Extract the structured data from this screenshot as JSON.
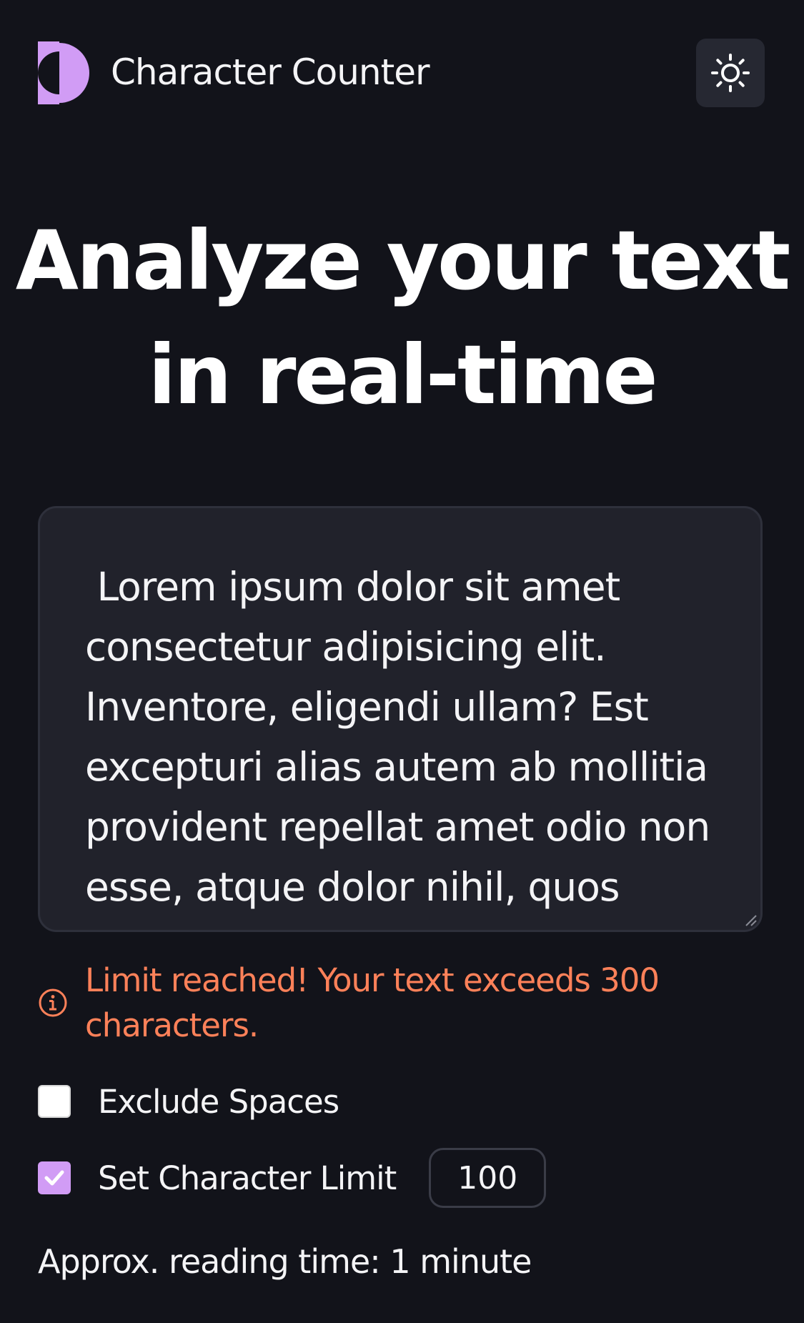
{
  "header": {
    "title": "Character Counter",
    "logo_icon": "half-moon-logo",
    "theme_toggle_icon": "sun-icon"
  },
  "hero": {
    "line1": "Analyze your text",
    "line2": "in real-time"
  },
  "textarea": {
    "value": " Lorem ipsum dolor sit amet consectetur adipisicing elit. Inventore, eligendi ullam? Est excepturi alias autem ab mollitia provident repellat amet odio non esse, atque dolor nihil, quos minima dignissimos officiis iste doloremque."
  },
  "warning": {
    "icon": "info-icon",
    "text": "Limit reached! Your text exceeds 300 characters."
  },
  "options": {
    "exclude_spaces": {
      "label": "Exclude Spaces",
      "checked": false
    },
    "character_limit": {
      "label": "Set Character Limit",
      "checked": true,
      "value": "100"
    }
  },
  "reading_time": "Approx. reading time: 1 minute",
  "colors": {
    "background": "#12131a",
    "accent": "#d19cf5",
    "warning": "#fe8159",
    "panel": "#21222b"
  }
}
